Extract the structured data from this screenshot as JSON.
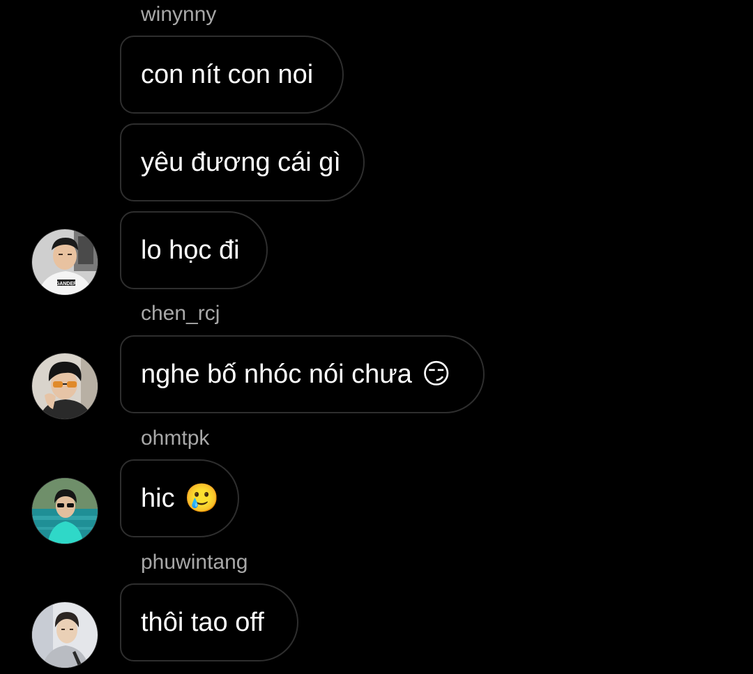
{
  "colors": {
    "background": "#000000",
    "bubble_border": "#2e2e2e",
    "sender_name": "#a8a8a8",
    "message_text": "#ffffff"
  },
  "messages": [
    {
      "sender": "winynny",
      "text": "con nít con noi",
      "emoji": ""
    },
    {
      "sender": "",
      "text": "yêu đương cái gì",
      "emoji": ""
    },
    {
      "sender": "",
      "text": "lo học đi",
      "emoji": ""
    },
    {
      "sender": "chen_rcj",
      "text": "nghe bố nhóc nói chưa",
      "emoji": "😏"
    },
    {
      "sender": "ohmtpk",
      "text": "hic",
      "emoji": "🥲"
    },
    {
      "sender": "phuwintang",
      "text": "thôi tao off",
      "emoji": ""
    }
  ],
  "avatars": [
    {
      "icon": "avatar-winynny",
      "shirt_text": "GANDER"
    },
    {
      "icon": "avatar-chen-rcj"
    },
    {
      "icon": "avatar-ohmtpk"
    },
    {
      "icon": "avatar-phuwintang"
    }
  ]
}
